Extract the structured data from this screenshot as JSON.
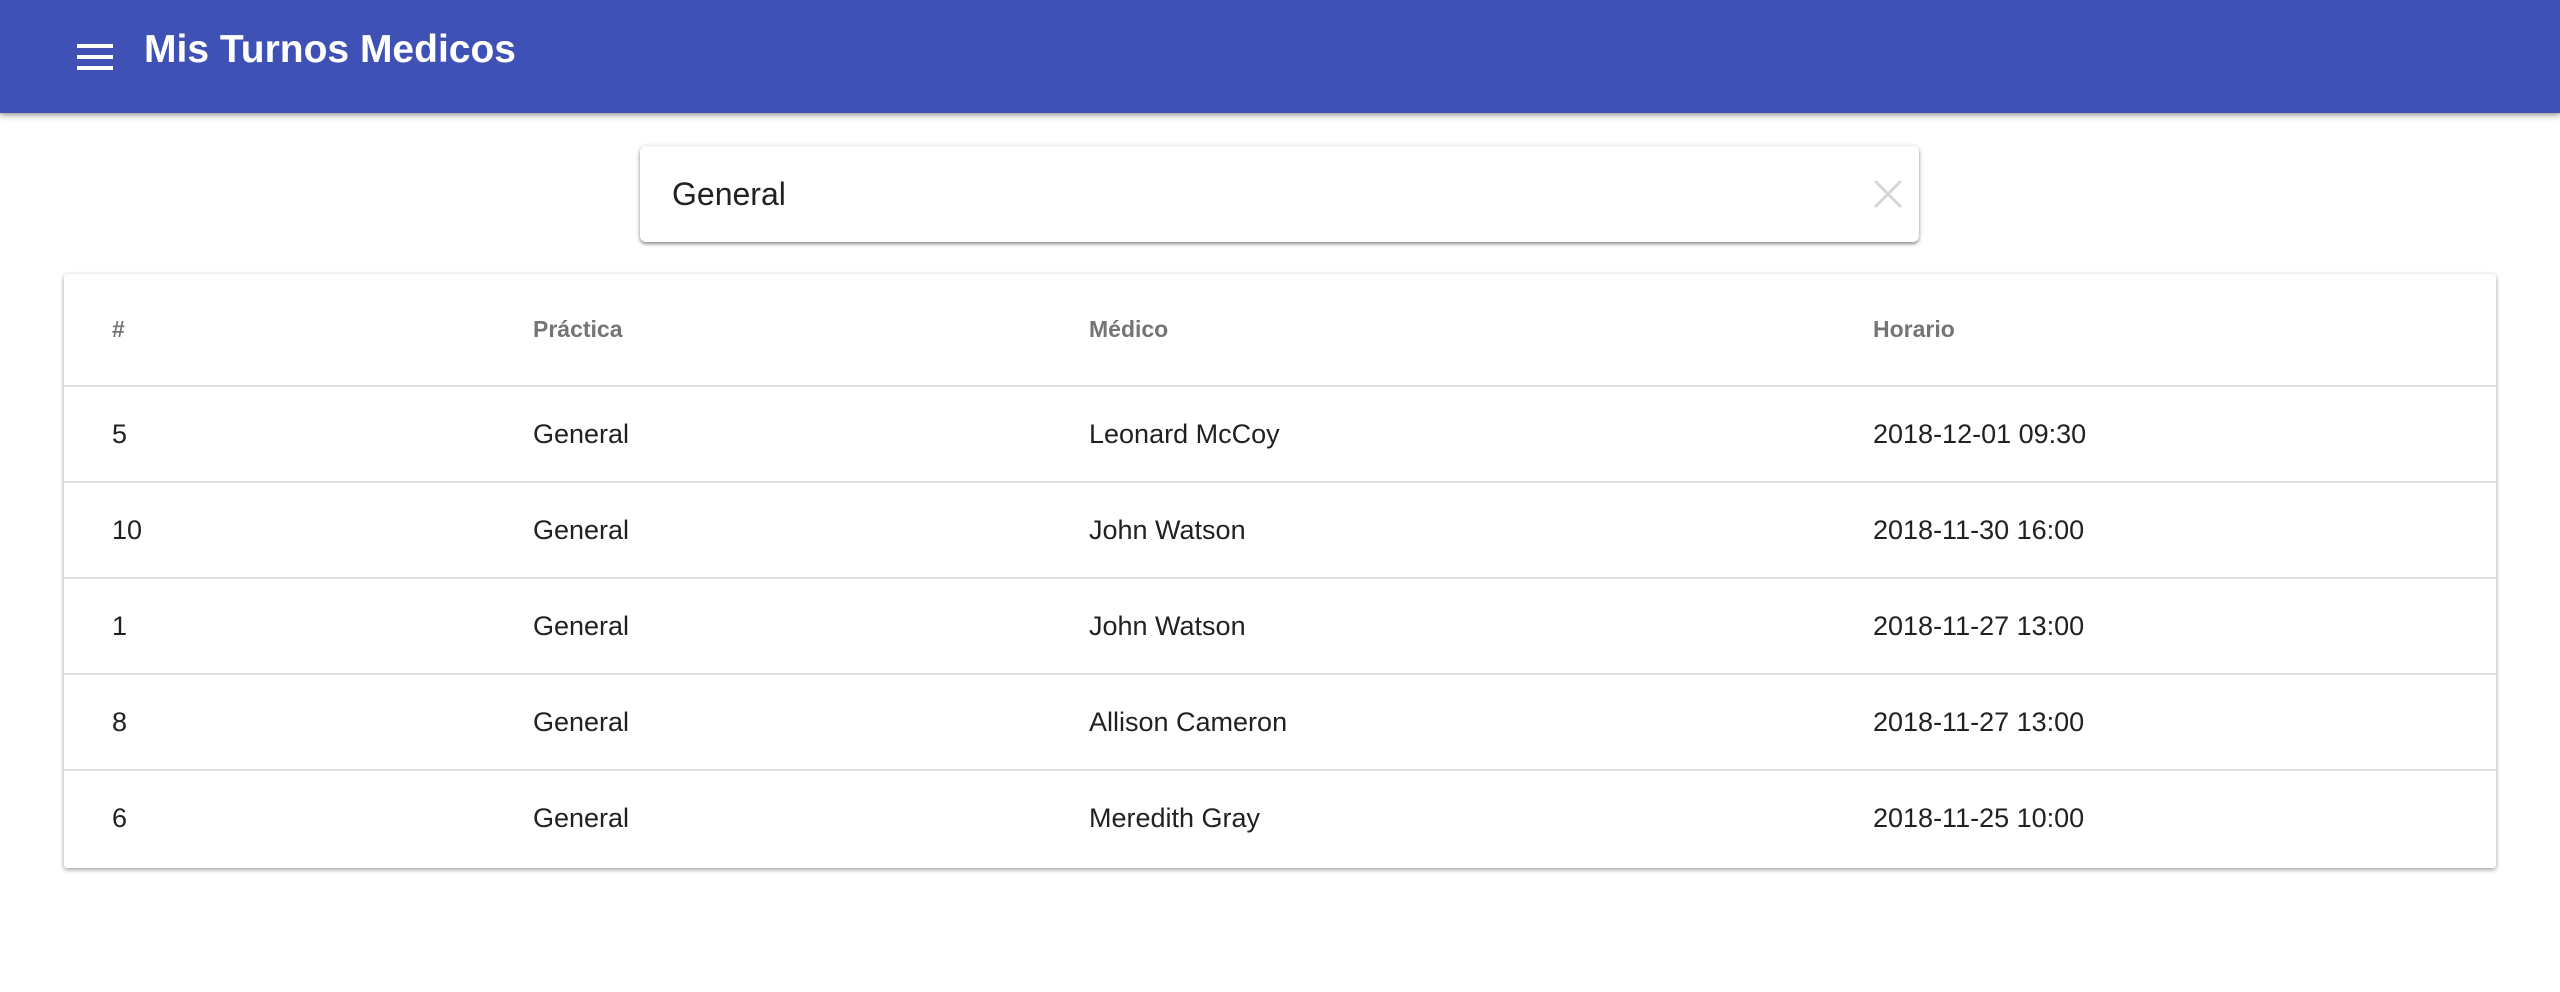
{
  "app": {
    "title": "Mis Turnos Medicos",
    "primary_color": "#3f51b5",
    "menu_icon": "menu-icon"
  },
  "search": {
    "value": "General",
    "placeholder": "",
    "clear_icon": "close-icon"
  },
  "table": {
    "headers": [
      "#",
      "Práctica",
      "Médico",
      "Horario"
    ],
    "rows": [
      {
        "id": "5",
        "practica": "General",
        "medico": "Leonard McCoy",
        "horario": "2018-12-01 09:30"
      },
      {
        "id": "10",
        "practica": "General",
        "medico": "John Watson",
        "horario": "2018-11-30 16:00"
      },
      {
        "id": "1",
        "practica": "General",
        "medico": "John Watson",
        "horario": "2018-11-27 13:00"
      },
      {
        "id": "8",
        "practica": "General",
        "medico": "Allison Cameron",
        "horario": "2018-11-27 13:00"
      },
      {
        "id": "6",
        "practica": "General",
        "medico": "Meredith Gray",
        "horario": "2018-11-25 10:00"
      }
    ]
  }
}
